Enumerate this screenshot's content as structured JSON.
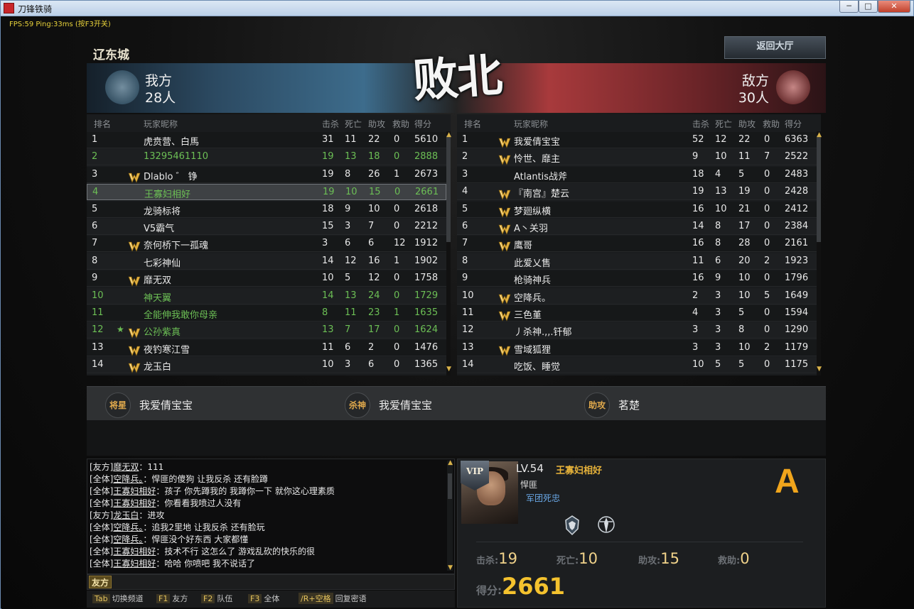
{
  "window": {
    "title": "刀锋铁骑",
    "minimize": "─",
    "maximize": "□",
    "close": "✕"
  },
  "overlay": {
    "fps": "FPS:59 Ping:33ms (按F3开关)"
  },
  "map_name": "辽东城",
  "back_button": "返回大厅",
  "result_text": "败北",
  "my_team": {
    "label": "我方",
    "count": "28人"
  },
  "enemy_team": {
    "label": "敌方",
    "count": "30人"
  },
  "headers": {
    "rank": "排名",
    "name": "玩家昵称",
    "kills": "击杀",
    "deaths": "死亡",
    "assists": "助攻",
    "rescues": "救助",
    "score": "得分"
  },
  "my_players": [
    {
      "rank": "1",
      "badge": false,
      "star": false,
      "name": "虎贲营、白馬",
      "k": "31",
      "d": "11",
      "a": "22",
      "r": "0",
      "s": "5610",
      "style": "normal"
    },
    {
      "rank": "2",
      "badge": false,
      "star": false,
      "name": "13295461110",
      "k": "19",
      "d": "13",
      "a": "18",
      "r": "0",
      "s": "2888",
      "style": "green"
    },
    {
      "rank": "3",
      "badge": true,
      "star": false,
      "name": "Dlablo ゛ 铮",
      "k": "19",
      "d": "8",
      "a": "26",
      "r": "1",
      "s": "2673",
      "style": "normal"
    },
    {
      "rank": "4",
      "badge": false,
      "star": false,
      "name": "王寡妇相好",
      "k": "19",
      "d": "10",
      "a": "15",
      "r": "0",
      "s": "2661",
      "style": "sel"
    },
    {
      "rank": "5",
      "badge": false,
      "star": false,
      "name": "龙骑标将",
      "k": "18",
      "d": "9",
      "a": "10",
      "r": "0",
      "s": "2618",
      "style": "normal"
    },
    {
      "rank": "6",
      "badge": false,
      "star": false,
      "name": "V5霸气",
      "k": "15",
      "d": "3",
      "a": "7",
      "r": "0",
      "s": "2212",
      "style": "normal"
    },
    {
      "rank": "7",
      "badge": true,
      "star": false,
      "name": "奈何桥下一孤魂",
      "k": "3",
      "d": "6",
      "a": "6",
      "r": "12",
      "s": "1912",
      "style": "normal"
    },
    {
      "rank": "8",
      "badge": false,
      "star": false,
      "name": "七彩神仙",
      "k": "14",
      "d": "12",
      "a": "16",
      "r": "1",
      "s": "1902",
      "style": "normal"
    },
    {
      "rank": "9",
      "badge": true,
      "star": false,
      "name": "靡无双",
      "k": "10",
      "d": "5",
      "a": "12",
      "r": "0",
      "s": "1758",
      "style": "normal"
    },
    {
      "rank": "10",
      "badge": false,
      "star": false,
      "name": "神天翼",
      "k": "14",
      "d": "13",
      "a": "24",
      "r": "0",
      "s": "1729",
      "style": "green"
    },
    {
      "rank": "11",
      "badge": false,
      "star": false,
      "name": "全能伸我敢你母亲",
      "k": "8",
      "d": "11",
      "a": "23",
      "r": "1",
      "s": "1635",
      "style": "green"
    },
    {
      "rank": "12",
      "badge": true,
      "star": true,
      "name": "公孙紫真",
      "k": "13",
      "d": "7",
      "a": "17",
      "r": "0",
      "s": "1624",
      "style": "green"
    },
    {
      "rank": "13",
      "badge": true,
      "star": false,
      "name": "夜钓寒江雪",
      "k": "11",
      "d": "6",
      "a": "2",
      "r": "0",
      "s": "1476",
      "style": "normal"
    },
    {
      "rank": "14",
      "badge": true,
      "star": false,
      "name": "龙玉白",
      "k": "10",
      "d": "3",
      "a": "6",
      "r": "0",
      "s": "1365",
      "style": "normal"
    }
  ],
  "enemy_players": [
    {
      "rank": "1",
      "badge": true,
      "name": "我爱倩宝宝",
      "k": "52",
      "d": "12",
      "a": "22",
      "r": "0",
      "s": "6363"
    },
    {
      "rank": "2",
      "badge": true,
      "name": "怜世、靡主",
      "k": "9",
      "d": "10",
      "a": "11",
      "r": "7",
      "s": "2522"
    },
    {
      "rank": "3",
      "badge": false,
      "name": "Atlantis战斧",
      "k": "18",
      "d": "4",
      "a": "5",
      "r": "0",
      "s": "2483"
    },
    {
      "rank": "4",
      "badge": true,
      "name": "『南宫』楚云",
      "k": "19",
      "d": "13",
      "a": "19",
      "r": "0",
      "s": "2428"
    },
    {
      "rank": "5",
      "badge": true,
      "name": "梦廻纵横",
      "k": "16",
      "d": "10",
      "a": "21",
      "r": "0",
      "s": "2412"
    },
    {
      "rank": "6",
      "badge": true,
      "name": "A丶关羽",
      "k": "14",
      "d": "8",
      "a": "17",
      "r": "0",
      "s": "2384"
    },
    {
      "rank": "7",
      "badge": true,
      "name": "鹰哥",
      "k": "16",
      "d": "8",
      "a": "28",
      "r": "0",
      "s": "2161"
    },
    {
      "rank": "8",
      "badge": false,
      "name": "此爱乂售",
      "k": "11",
      "d": "6",
      "a": "20",
      "r": "2",
      "s": "1923"
    },
    {
      "rank": "9",
      "badge": false,
      "name": "枪骑神兵",
      "k": "16",
      "d": "9",
      "a": "10",
      "r": "0",
      "s": "1796"
    },
    {
      "rank": "10",
      "badge": true,
      "name": "空降兵。",
      "k": "2",
      "d": "3",
      "a": "10",
      "r": "5",
      "s": "1649"
    },
    {
      "rank": "11",
      "badge": true,
      "name": "三色堇",
      "k": "4",
      "d": "3",
      "a": "5",
      "r": "0",
      "s": "1594"
    },
    {
      "rank": "12",
      "badge": false,
      "name": "丿杀神.,,.钎郁",
      "k": "3",
      "d": "3",
      "a": "8",
      "r": "0",
      "s": "1290"
    },
    {
      "rank": "13",
      "badge": true,
      "name": "雪域狐狸",
      "k": "3",
      "d": "3",
      "a": "10",
      "r": "2",
      "s": "1179"
    },
    {
      "rank": "14",
      "badge": false,
      "name": "吃饭、睡觉",
      "k": "10",
      "d": "5",
      "a": "5",
      "r": "0",
      "s": "1175"
    }
  ],
  "awards": [
    {
      "title": "将星",
      "player": "我爱倩宝宝"
    },
    {
      "title": "杀神",
      "player": "我爱倩宝宝"
    },
    {
      "title": "助攻王",
      "player": "茗楚"
    }
  ],
  "chat": [
    {
      "channel": "[友方]",
      "who": "靡无双",
      "msg": "：111"
    },
    {
      "channel": "[全体]",
      "who": "空降兵。",
      "msg": "：悍匪的傻狗  让我反杀 还有脸蹲"
    },
    {
      "channel": "[全体]",
      "who": "王寡妇相好",
      "msg": "：孩子  你先蹲我的 我蹲你一下 就你这心理素质"
    },
    {
      "channel": "[全体]",
      "who": "王寡妇相好",
      "msg": "：你看看我喷过人没有"
    },
    {
      "channel": "[友方]",
      "who": "龙玉白",
      "msg": "：进攻"
    },
    {
      "channel": "[全体]",
      "who": "空降兵。",
      "msg": "：追我2里地  让我反杀  还有脸玩"
    },
    {
      "channel": "[全体]",
      "who": "空降兵。",
      "msg": "：悍匪没个好东西  大家都懂"
    },
    {
      "channel": "[全体]",
      "who": "王寡妇相好",
      "msg": "：技术不行 这怎么了  游戏乱砍的快乐的很"
    },
    {
      "channel": "[全体]",
      "who": "王寡妇相好",
      "msg": "：哈哈  你喷吧 我不说话了"
    }
  ],
  "chat_channel_button": "友方",
  "hotkeys": [
    {
      "key": "Tab",
      "label": "切换频道"
    },
    {
      "key": "F1",
      "label": "友方"
    },
    {
      "key": "F2",
      "label": "队伍"
    },
    {
      "key": "F3",
      "label": "全体"
    },
    {
      "key": "/R+空格",
      "label": "回复密语"
    }
  ],
  "player_card": {
    "vip": "VIP",
    "level": "LV.54",
    "name": "王寡妇相好",
    "title": "悍匪",
    "guild": "军团死忠",
    "grade": "A",
    "kills_label": "击杀:",
    "kills": "19",
    "deaths_label": "死亡:",
    "deaths": "10",
    "assists_label": "助攻:",
    "assists": "15",
    "rescues_label": "救助:",
    "rescues": "0",
    "score_label": "得分:",
    "score": "2661"
  },
  "colors": {
    "accent_gold": "#f0a51c",
    "friend_green": "#6cbf55",
    "my_team_blue": "#3d6c8c",
    "enemy_red": "#a83a3c"
  }
}
